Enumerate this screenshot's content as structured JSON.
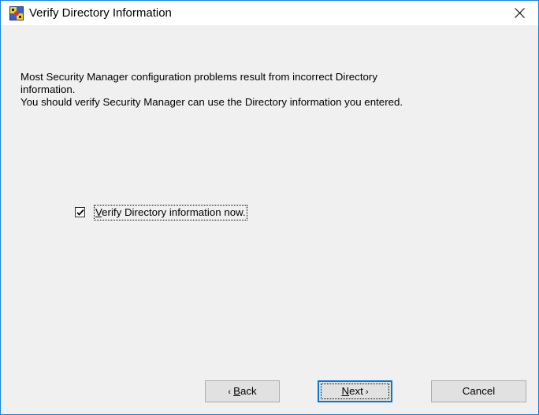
{
  "window": {
    "title": "Verify Directory Information",
    "close_glyph": "×"
  },
  "message": {
    "line1": "Most Security Manager configuration problems result from incorrect Directory",
    "line2": "information.",
    "line3": "You should verify Security Manager can use the Directory information you entered."
  },
  "checkbox": {
    "label_mnemonic": "V",
    "label_rest": "erify Directory information now.",
    "checked": true
  },
  "buttons": {
    "back_prefix": "‹ ",
    "back_mnemonic": "B",
    "back_rest": "ack",
    "next_mnemonic": "N",
    "next_rest": "ext",
    "next_suffix": " ›",
    "cancel": "Cancel"
  },
  "colors": {
    "window_border": "#1883d7",
    "background": "#f0f0f0",
    "button_face": "#e1e1e1",
    "default_button_border": "#0078d7"
  }
}
